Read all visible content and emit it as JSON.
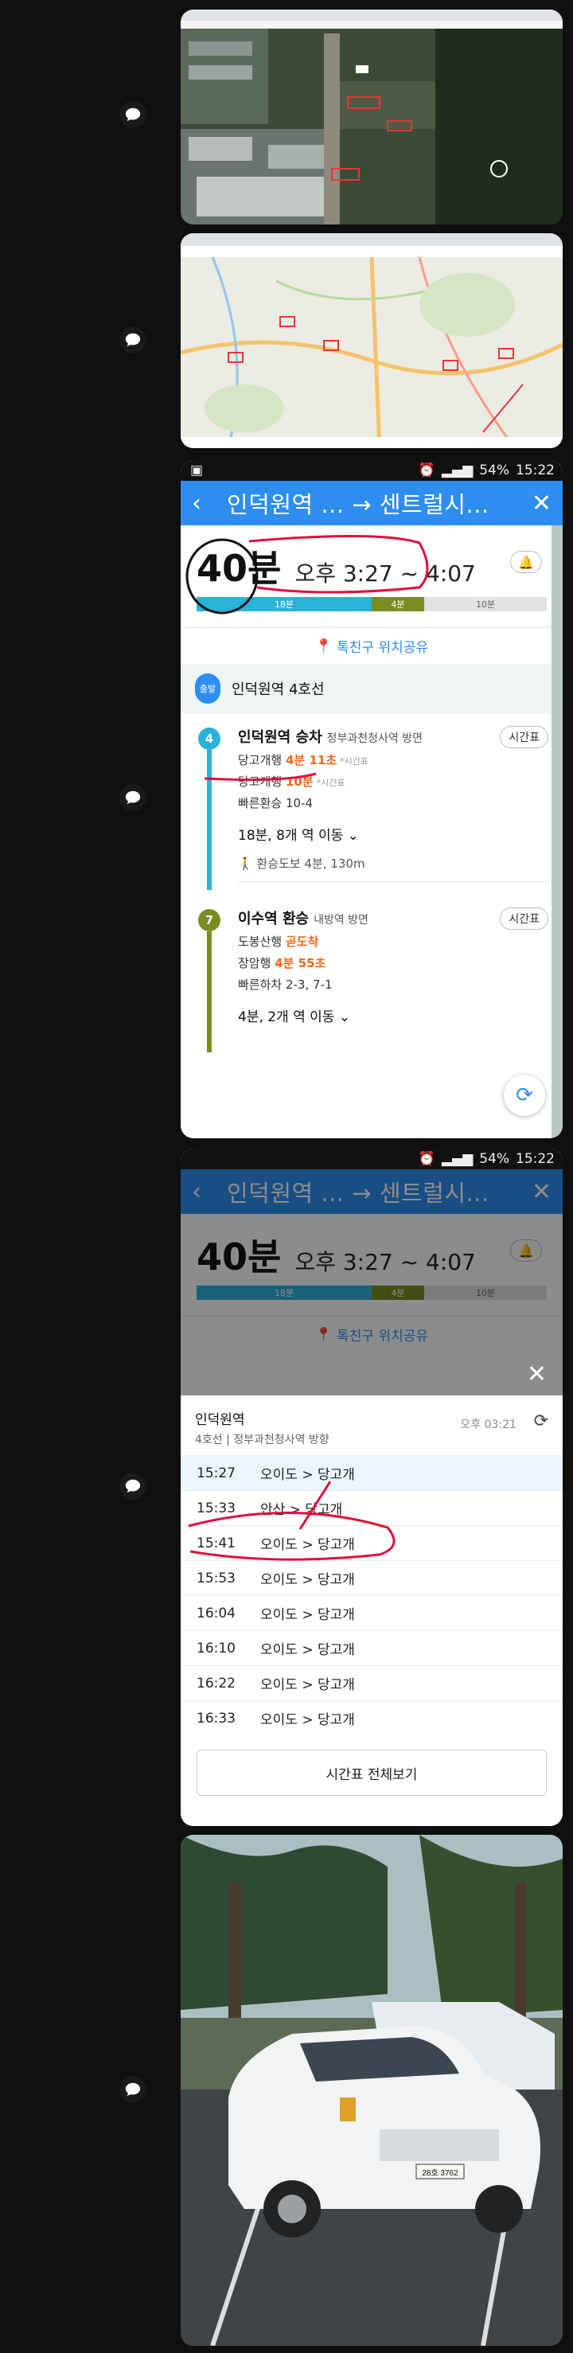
{
  "status": {
    "time": "15:22",
    "battery": "54%"
  },
  "app": {
    "title": "인덕원역 ... → 센트럴시...",
    "back_icon": "back-arrow-icon",
    "close_icon": "close-icon"
  },
  "summary": {
    "duration": "40분",
    "range": "오후 3:27 ~ 4:07",
    "segments": [
      {
        "label": "18분",
        "color": "#2ab3d8"
      },
      {
        "label": "4분",
        "color": "#7a8c22"
      },
      {
        "label": "10분",
        "color": "#e2e2e2"
      }
    ]
  },
  "share_label": "톡친구 위치공유",
  "departure": {
    "badge": "출발",
    "name": "인덕원역 4호선"
  },
  "legs": [
    {
      "line_no": "4",
      "color": "#2ab3d8",
      "station": "인덕원역 승차",
      "direction": "정부과천청사역 방면",
      "timetable_label": "시간표",
      "r1_prefix": "당고개행",
      "r1_value": "4분 11초",
      "r1_suffix": "*시간표",
      "r2_prefix": "당고개행",
      "r2_value": "10분",
      "r2_suffix": "*시간표",
      "fast": "빠른환승 10-4",
      "move": "18분, 8개 역 이동",
      "walk": "환승도보 4분, 130m"
    },
    {
      "line_no": "7",
      "color": "#7a8c22",
      "station": "이수역 환승",
      "direction": "내방역 방면",
      "timetable_label": "시간표",
      "r1_prefix": "도봉산행",
      "r1_value": "곧도착",
      "r2_prefix": "장암행",
      "r2_value": "4분 55초",
      "fast": "빠른하차 2-3, 7-1",
      "move": "4분, 2개 역 이동"
    }
  ],
  "timetable": {
    "station": "인덕원역",
    "line_dir": "4호선 | 정부과천청사역 방향",
    "now": "오후 03:21",
    "rows": [
      {
        "time": "15:27",
        "route": "오이도 > 당고개"
      },
      {
        "time": "15:33",
        "route": "안산 > 당고개"
      },
      {
        "time": "15:41",
        "route": "오이도 > 당고개"
      },
      {
        "time": "15:53",
        "route": "오이도 > 당고개"
      },
      {
        "time": "16:04",
        "route": "오이도 > 당고개"
      },
      {
        "time": "16:10",
        "route": "오이도 > 당고개"
      },
      {
        "time": "16:22",
        "route": "오이도 > 당고개"
      },
      {
        "time": "16:33",
        "route": "오이도 > 당고개"
      }
    ],
    "full_button": "시간표 전체보기"
  },
  "photo": {
    "plate": "28호 3762"
  }
}
